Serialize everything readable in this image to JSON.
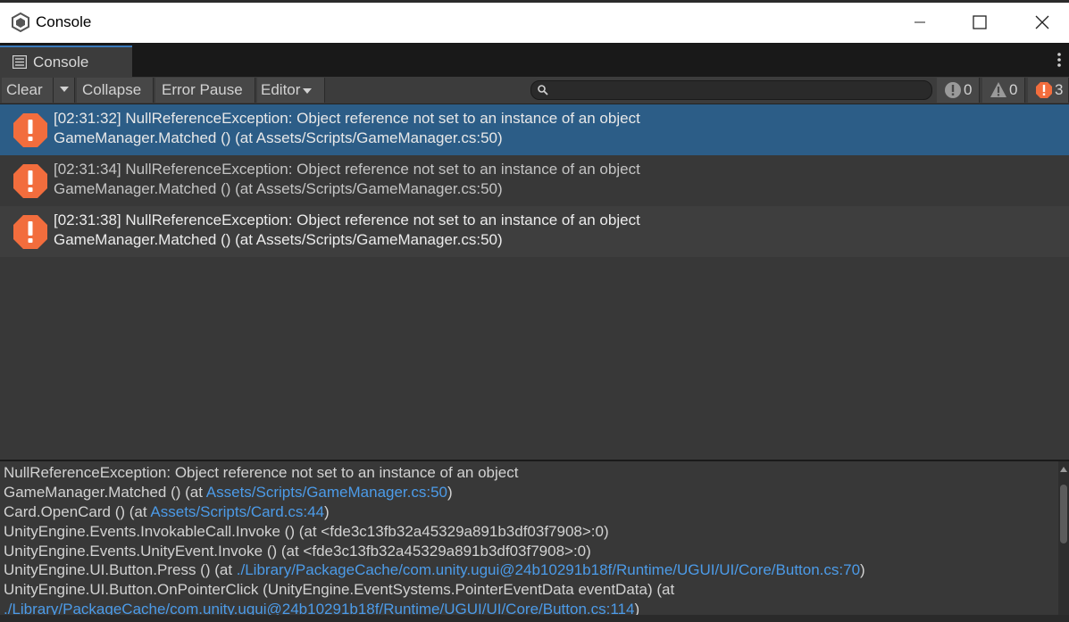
{
  "window": {
    "title": "Console",
    "app_icon": "unity-logo-icon",
    "controls": [
      "minimize-icon",
      "maximize-icon",
      "close-icon"
    ]
  },
  "tab": {
    "label": "Console",
    "icon": "console-list-icon",
    "menu_icon": "kebab-menu-icon"
  },
  "toolbar": {
    "clear_label": "Clear",
    "collapse_label": "Collapse",
    "error_pause_label": "Error Pause",
    "editor_label": "Editor",
    "search": {
      "placeholder": "",
      "value": ""
    },
    "counters": {
      "log": "0",
      "warning": "0",
      "error": "3"
    }
  },
  "log_entries": [
    {
      "line1": "[02:31:32] NullReferenceException: Object reference not set to an instance of an object",
      "line2": "GameManager.Matched () (at Assets/Scripts/GameManager.cs:50)",
      "selected": true
    },
    {
      "line1": "[02:31:34] NullReferenceException: Object reference not set to an instance of an object",
      "line2": "GameManager.Matched () (at Assets/Scripts/GameManager.cs:50)",
      "selected": false
    },
    {
      "line1": "[02:31:38] NullReferenceException: Object reference not set to an instance of an object",
      "line2": "GameManager.Matched () (at Assets/Scripts/GameManager.cs:50)",
      "selected": false
    }
  ],
  "detail": {
    "l0": "NullReferenceException: Object reference not set to an instance of an object",
    "l1_pre": "GameManager.Matched () (at ",
    "l1_link": "Assets/Scripts/GameManager.cs:50",
    "l1_post": ")",
    "l2_pre": "Card.OpenCard () (at ",
    "l2_link": "Assets/Scripts/Card.cs:44",
    "l2_post": ")",
    "l3": "UnityEngine.Events.InvokableCall.Invoke () (at <fde3c13fb32a45329a891b3df03f7908>:0)",
    "l4": "UnityEngine.Events.UnityEvent.Invoke () (at <fde3c13fb32a45329a891b3df03f7908>:0)",
    "l5_pre": "UnityEngine.UI.Button.Press () (at ",
    "l5_link": "./Library/PackageCache/com.unity.ugui@24b10291b18f/Runtime/UGUI/UI/Core/Button.cs:70",
    "l5_post": ")",
    "l6": "UnityEngine.UI.Button.OnPointerClick (UnityEngine.EventSystems.PointerEventData eventData) (at",
    "l7_link": "./Library/PackageCache/com.unity.ugui@24b10291b18f/Runtime/UGUI/UI/Core/Button.cs:114",
    "l7_post": ")"
  },
  "colors": {
    "selected_row": "#2c5d87",
    "error_icon": "#f26d3d",
    "link": "#4c9be8",
    "tab_accent": "#3a79bb"
  }
}
